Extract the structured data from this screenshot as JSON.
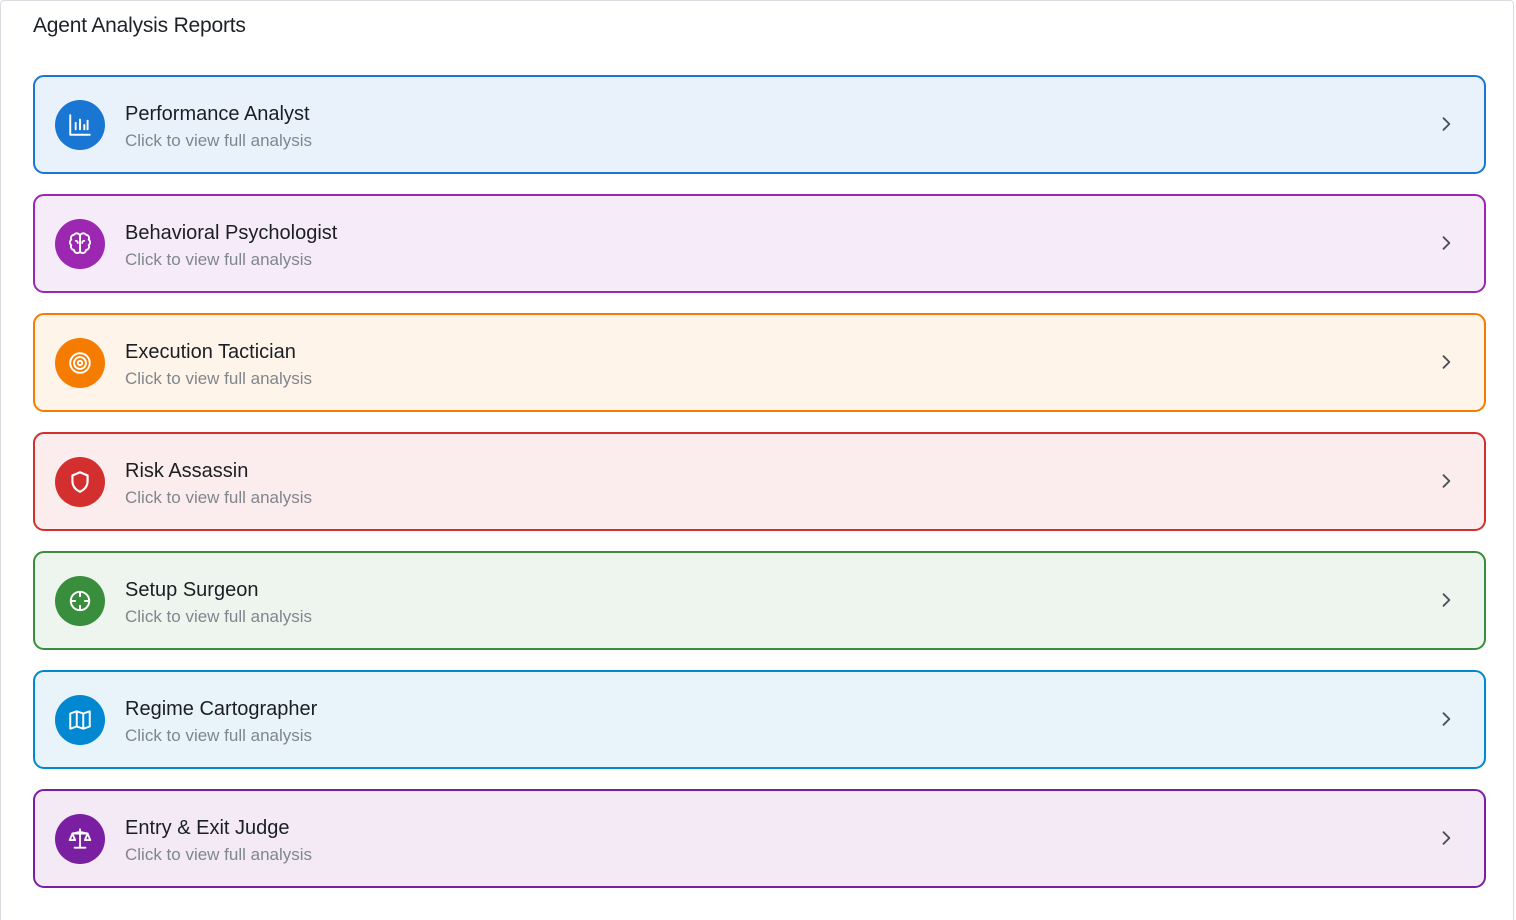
{
  "page": {
    "title": "Agent Analysis Reports"
  },
  "cards": [
    {
      "title": "Performance Analyst",
      "subtitle": "Click to view full analysis",
      "icon": "bar-chart-icon",
      "border": "#1976d2",
      "bg": "#e9f2fb",
      "iconBg": "#1976d2"
    },
    {
      "title": "Behavioral Psychologist",
      "subtitle": "Click to view full analysis",
      "icon": "brain-icon",
      "border": "#9c27b0",
      "bg": "#f6ebf8",
      "iconBg": "#9c27b0"
    },
    {
      "title": "Execution Tactician",
      "subtitle": "Click to view full analysis",
      "icon": "target-icon",
      "border": "#f57c00",
      "bg": "#fef4ea",
      "iconBg": "#f57c00"
    },
    {
      "title": "Risk Assassin",
      "subtitle": "Click to view full analysis",
      "icon": "shield-icon",
      "border": "#d32f2f",
      "bg": "#fbeced",
      "iconBg": "#d32f2f"
    },
    {
      "title": "Setup Surgeon",
      "subtitle": "Click to view full analysis",
      "icon": "crosshair-icon",
      "border": "#388e3c",
      "bg": "#eef5ef",
      "iconBg": "#388e3c"
    },
    {
      "title": "Regime Cartographer",
      "subtitle": "Click to view full analysis",
      "icon": "map-icon",
      "border": "#0288d1",
      "bg": "#e8f3fa",
      "iconBg": "#0288d1"
    },
    {
      "title": "Entry & Exit Judge",
      "subtitle": "Click to view full analysis",
      "icon": "scale-icon",
      "border": "#7b1fa2",
      "bg": "#f3eaf6",
      "iconBg": "#7b1fa2"
    }
  ]
}
